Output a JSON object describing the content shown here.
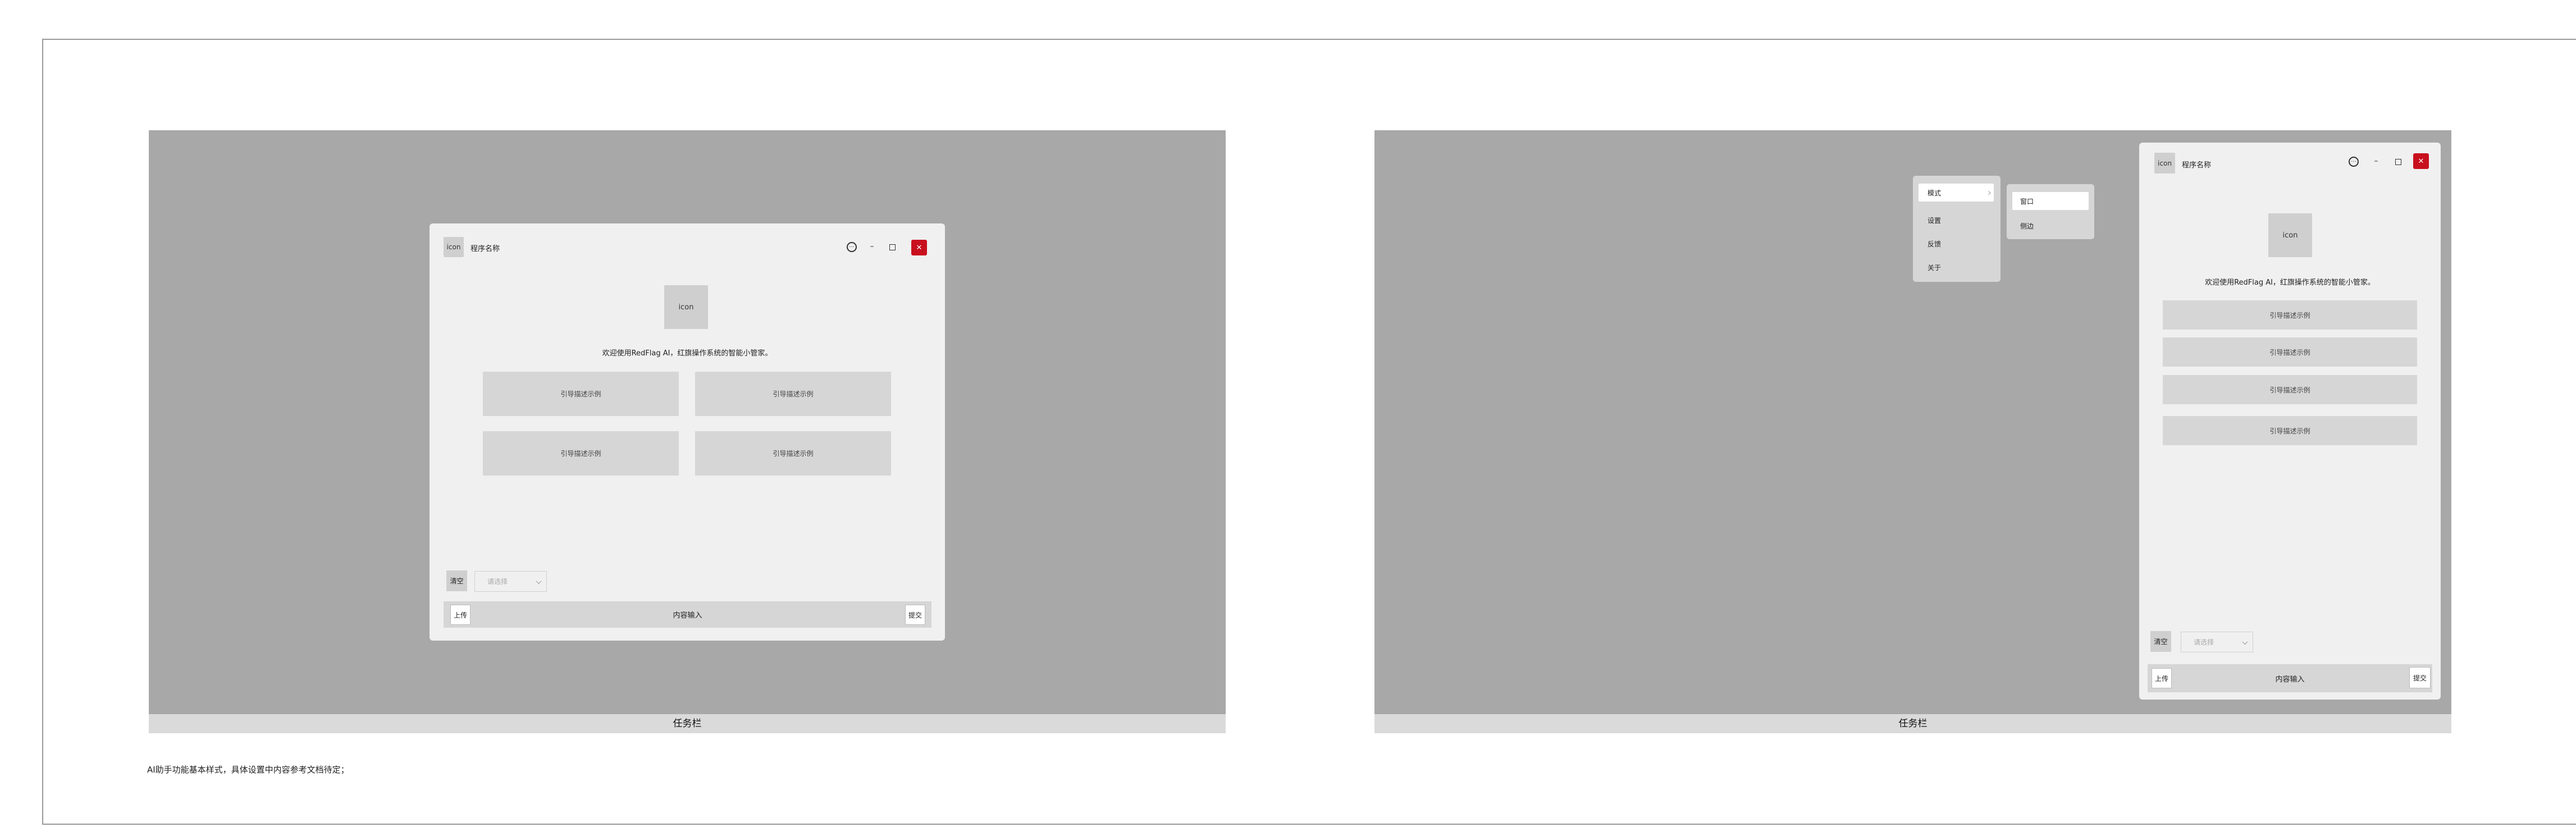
{
  "left": {
    "taskbar": "任务栏",
    "window": {
      "icon_label": "icon",
      "app_name": "程序名称",
      "logo_label": "icon",
      "welcome": "欢迎使用RedFlag AI，红旗操作系统的智能小管家。",
      "cards": [
        "引导描述示例",
        "引导描述示例",
        "引导描述示例",
        "引导描述示例"
      ],
      "clear_label": "清空",
      "select_placeholder": "请选择",
      "upload_label": "上传",
      "input_placeholder": "内容输入",
      "submit_label": "提交"
    }
  },
  "right": {
    "taskbar": "任务栏",
    "menu": {
      "items": [
        "模式",
        "设置",
        "反馈",
        "关于"
      ],
      "submenu": [
        "窗口",
        "侧边"
      ]
    },
    "window": {
      "icon_label": "icon",
      "app_name": "程序名称",
      "logo_label": "icon",
      "welcome": "欢迎使用RedFlag AI，红旗操作系统的智能小管家。",
      "cards": [
        "引导描述示例",
        "引导描述示例",
        "引导描述示例",
        "引导描述示例"
      ],
      "clear_label": "清空",
      "select_placeholder": "请选择",
      "upload_label": "上传",
      "input_placeholder": "内容输入",
      "submit_label": "提交"
    }
  },
  "caption": "AI助手功能基本样式，具体设置中内容参考文档待定；",
  "colors": {
    "accent_close": "#c8101e",
    "desktop": "#a8a8a8",
    "window": "#f0f0f0"
  }
}
